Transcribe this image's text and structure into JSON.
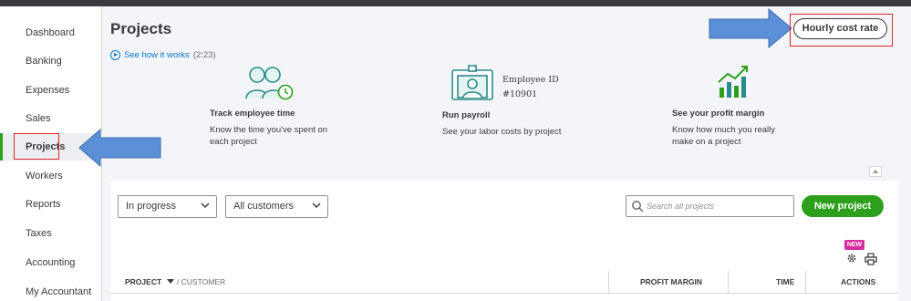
{
  "sidebar": {
    "items": [
      {
        "label": "Dashboard"
      },
      {
        "label": "Banking"
      },
      {
        "label": "Expenses"
      },
      {
        "label": "Sales"
      },
      {
        "label": "Projects",
        "active": true
      },
      {
        "label": "Workers"
      },
      {
        "label": "Reports"
      },
      {
        "label": "Taxes"
      },
      {
        "label": "Accounting"
      },
      {
        "label": "My Accountant"
      }
    ]
  },
  "header": {
    "title": "Projects",
    "see_how_label": "See how it works",
    "see_how_duration": "(2:23)",
    "hourly_cost_button": "Hourly cost rate"
  },
  "features": [
    {
      "title": "Track employee time",
      "desc_line1": "Know the time you've spent on",
      "desc_line2": "each project",
      "icon": "people-clock-icon"
    },
    {
      "title": "Run payroll",
      "desc_line1": "See your labor costs by project",
      "icon": "id-badge-icon",
      "badge_line1": "Employee ID",
      "badge_line2": "#10901"
    },
    {
      "title": "See your profit margin",
      "desc_line1": "Know how much you really",
      "desc_line2": "make on a project",
      "icon": "chart-up-icon"
    }
  ],
  "filters": {
    "status_selected": "In progress",
    "customer_selected": "All customers"
  },
  "search": {
    "placeholder": "Search all projects"
  },
  "new_project_button": "New project",
  "new_badge": "NEW",
  "table": {
    "columns": {
      "project": "PROJECT",
      "customer": "/ CUSTOMER",
      "profit_margin": "PROFIT MARGIN",
      "time": "TIME",
      "actions": "ACTIONS"
    }
  },
  "colors": {
    "accent_green": "#2ca01c",
    "link_blue": "#0077c5",
    "highlight_red": "#e0262b",
    "arrow_blue": "#5b8fd6",
    "badge_pink": "#d52b9c"
  }
}
